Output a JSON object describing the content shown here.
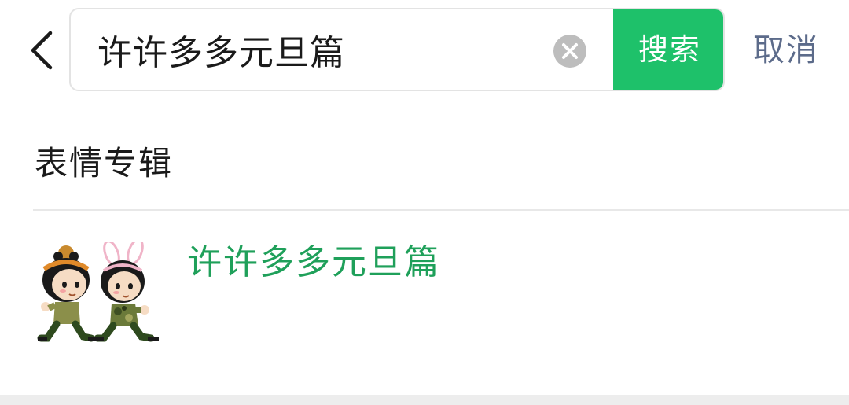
{
  "header": {
    "back_icon": "chevron-left-icon",
    "search": {
      "value": "许许多多元旦篇",
      "placeholder": ""
    },
    "clear_icon": "clear-circle-icon",
    "search_button_label": "搜索",
    "cancel_label": "取消",
    "accent_color": "#1ec16a",
    "link_color": "#5c6b8a"
  },
  "section": {
    "title": "表情专辑"
  },
  "results": [
    {
      "title": "许许多多元旦篇",
      "thumbnail": "sticker-pack-thumbnail",
      "title_color": "#1fa05a"
    }
  ]
}
